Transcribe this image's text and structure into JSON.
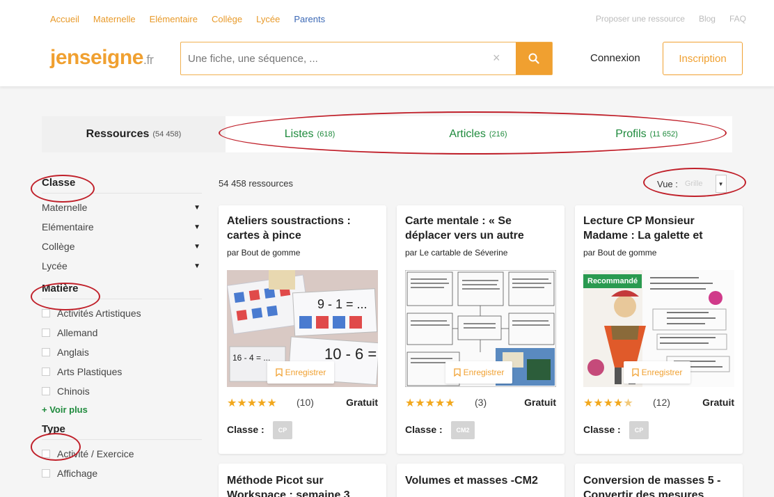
{
  "header": {
    "nav": [
      "Accueil",
      "Maternelle",
      "Elémentaire",
      "Collège",
      "Lycée",
      "Parents"
    ],
    "links": [
      "Proposer une ressource",
      "Blog",
      "FAQ"
    ],
    "logo_main": "jenseigne",
    "logo_suffix": ".fr",
    "search_placeholder": "Une fiche, une séquence, ...",
    "search_clear": "×",
    "connexion": "Connexion",
    "inscription": "Inscription"
  },
  "tabs": [
    {
      "label": "Ressources",
      "count": "(54 458)"
    },
    {
      "label": "Listes",
      "count": "(618)"
    },
    {
      "label": "Articles",
      "count": "(216)"
    },
    {
      "label": "Profils",
      "count": "(11 652)"
    }
  ],
  "sidebar": {
    "classe_title": "Classe",
    "classes": [
      "Maternelle",
      "Elémentaire",
      "Collège",
      "Lycée"
    ],
    "matiere_title": "Matière",
    "matieres": [
      "Activités Artistiques",
      "Allemand",
      "Anglais",
      "Arts Plastiques",
      "Chinois"
    ],
    "voir_plus": "+ Voir plus",
    "type_title": "Type",
    "types": [
      "Activité / Exercice",
      "Affichage"
    ]
  },
  "results": {
    "count": "54 458 ressources",
    "vue_label": "Vue :",
    "vue_value": "Grille"
  },
  "cards": [
    {
      "title": "Ateliers soustractions : cartes à pince",
      "author": "par Bout de gomme",
      "save": "Enregistrer",
      "rating": 5,
      "reviews": "(10)",
      "price": "Gratuit",
      "classe_label": "Classe :",
      "classe": "CP"
    },
    {
      "title": "Carte mentale : « Se déplacer vers un autre",
      "author": "par Le cartable de Séverine",
      "save": "Enregistrer",
      "rating": 5,
      "reviews": "(3)",
      "price": "Gratuit",
      "classe_label": "Classe :",
      "classe": "CM2"
    },
    {
      "title": "Lecture CP Monsieur Madame : La galette et",
      "author": "par Bout de gomme",
      "save": "Enregistrer",
      "rating": 4.5,
      "reviews": "(12)",
      "price": "Gratuit",
      "classe_label": "Classe :",
      "classe": "CP",
      "badge": "Recommandé"
    }
  ],
  "cards_row2": [
    {
      "title": "Méthode Picot sur Workspace : semaine 3"
    },
    {
      "title": "Volumes et masses -CM2"
    },
    {
      "title": "Conversion de masses 5 -Convertir des mesures"
    }
  ],
  "colors": {
    "accent": "#f0a030",
    "green": "#1e8a3c",
    "annotation": "#c0202a",
    "star": "#f2a81d"
  }
}
